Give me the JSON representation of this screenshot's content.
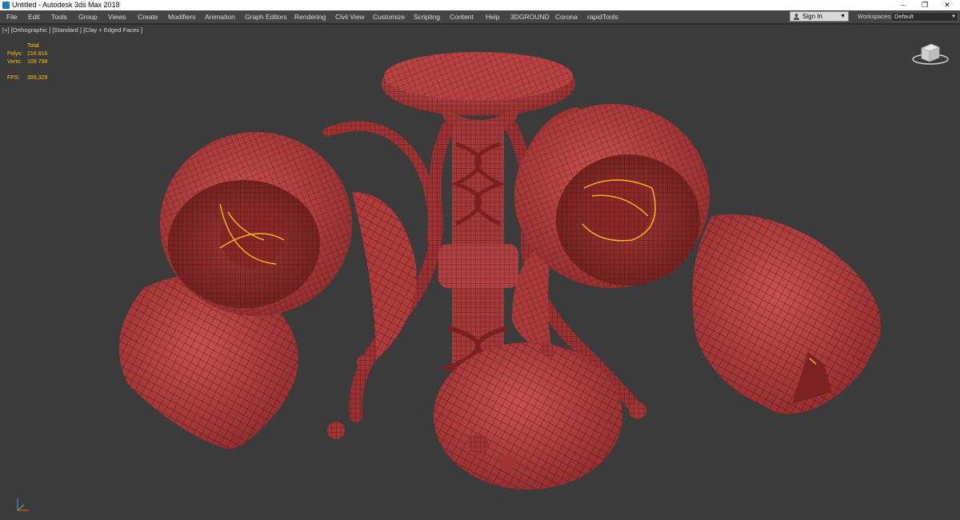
{
  "window": {
    "title": "Untitled - Autodesk 3ds Max 2018",
    "controls": {
      "minimize": "–",
      "maximize": "❐",
      "close": "✕"
    }
  },
  "menu": [
    "File",
    "Edit",
    "Tools",
    "Group",
    "Views",
    "Create",
    "Modifiers",
    "Animation",
    "Graph Editors",
    "Rendering",
    "Civil View",
    "Customize",
    "Scripting",
    "Content",
    "Help",
    "3DGROUND",
    "Corona",
    "rapidTools"
  ],
  "account": {
    "sign_in": "Sign In",
    "icon": "user-icon"
  },
  "workspaces": {
    "label": "Workspaces:",
    "value": "Default"
  },
  "viewport": {
    "label": "[+] [Orthographic ] [Standard ] [Clay + Edged Faces ]",
    "stats": {
      "header": "Total",
      "polys_label": "Polys:",
      "polys_value": "216 816",
      "verts_label": "Verts:",
      "verts_value": "109 798",
      "fps_label": "FPS:",
      "fps_value": "399,329"
    },
    "colors": {
      "background": "#3b3b3b",
      "clay": "#b83a3a",
      "wire": "#2a0a0a",
      "stats_text": "#f0c020",
      "selection": "#f2b41c"
    },
    "icons": {
      "viewcube": "viewcube-icon",
      "axis": "axis-gizmo-icon"
    }
  }
}
